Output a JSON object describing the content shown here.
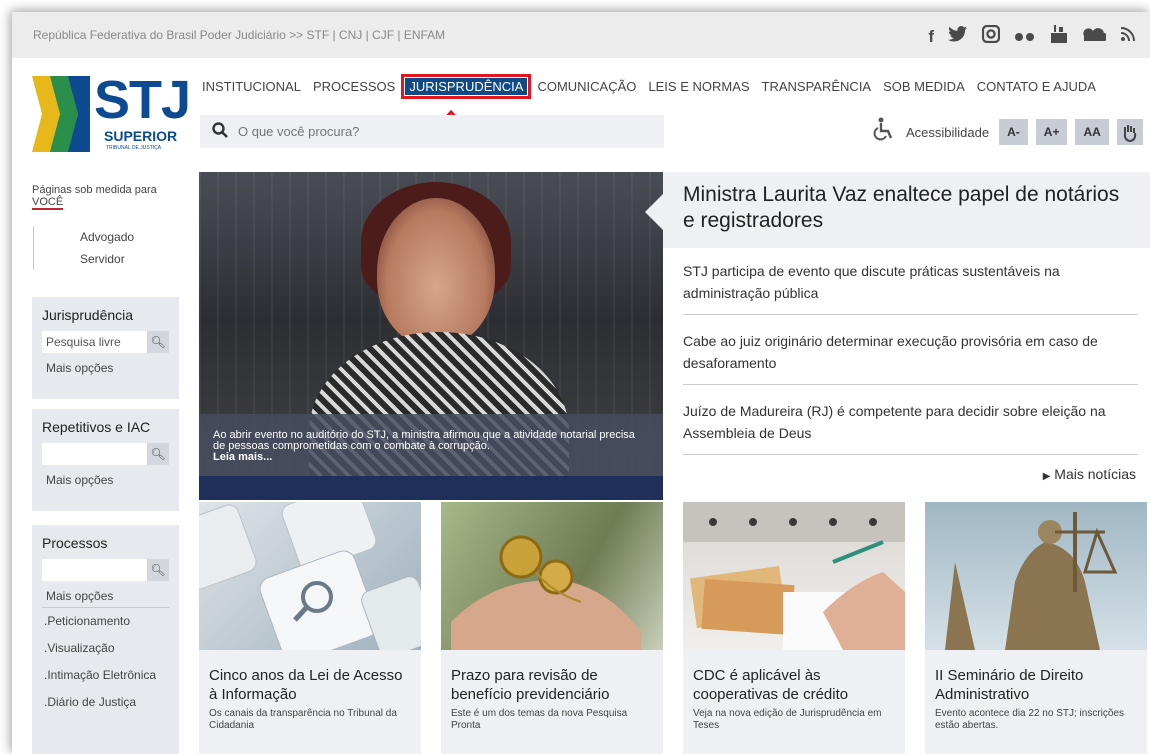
{
  "topbar": {
    "links": "República Federativa do Brasil Poder Judiciário >> STF | CNJ | CJF | ENFAM",
    "social_icons": [
      "facebook-icon",
      "twitter-icon",
      "instagram-icon",
      "flickr-icon",
      "youtube-icon",
      "soundcloud-icon",
      "rss-icon"
    ]
  },
  "logo": {
    "main": "STJ",
    "sub": "SUPERIOR",
    "tribunal": "TRIBUNAL DE JUSTIÇA",
    "colors": {
      "blue": "#0e4a8f",
      "green": "#2a8f4a",
      "yellow": "#e6b81a"
    }
  },
  "nav": {
    "items": [
      "INSTITUCIONAL",
      "PROCESSOS",
      "JURISPRUDÊNCIA",
      "COMUNICAÇÃO",
      "LEIS E NORMAS",
      "TRANSPARÊNCIA",
      "SOB MEDIDA",
      "CONTATO E AJUDA"
    ],
    "active": "JURISPRUDÊNCIA"
  },
  "search": {
    "placeholder": "O que você procura?"
  },
  "access": {
    "label": "Acessibilidade",
    "buttons": [
      "A-",
      "A+",
      "AA"
    ]
  },
  "sidebar": {
    "sob_title": "Páginas sob medida para",
    "sob_highlight": "VOCÊ",
    "sob_items": [
      "Advogado",
      "Servidor"
    ],
    "boxes": [
      {
        "title": "Jurisprudência",
        "input": "Pesquisa livre",
        "more": "Mais opções"
      },
      {
        "title": "Repetitivos e IAC",
        "input": "",
        "more": "Mais opções"
      },
      {
        "title": "Processos",
        "input": "",
        "more": "Mais opções",
        "links": [
          ".Peticionamento",
          ".Visualização",
          ".Intimação Eletrônica",
          ".Diário de Justiça"
        ]
      }
    ]
  },
  "hero": {
    "caption": "Ao abrir evento no auditório do STJ, a ministra afirmou que a atividade notarial precisa de pessoas comprometidas com o combate à corrupção.",
    "more": "Leia mais..."
  },
  "news": {
    "headline": "Ministra Laurita Vaz enaltece papel de notários e registradores",
    "items": [
      "STJ participa de evento que discute práticas sustentáveis na administração pública",
      "Cabe ao juiz originário determinar execução provisória em caso de desaforamento",
      "Juízo de Madureira (RJ) é competente para decidir sobre eleição na Assembleia de Deus"
    ],
    "more": "Mais notícias"
  },
  "cards": [
    {
      "title": "Cinco anos da Lei de Acesso à Informação",
      "desc": "Os canais da transparência no Tribunal da Cidadania"
    },
    {
      "title": "Prazo para revisão de benefício previdenciário",
      "desc": "Este é um dos temas da nova Pesquisa Pronta"
    },
    {
      "title": "CDC é aplicável às cooperativas de crédito",
      "desc": "Veja na nova edição de Jurisprudência em Teses"
    },
    {
      "title": "II Seminário de Direito Administrativo",
      "desc": "Evento acontece dia 22 no STJ; inscrições estão abertas."
    }
  ]
}
